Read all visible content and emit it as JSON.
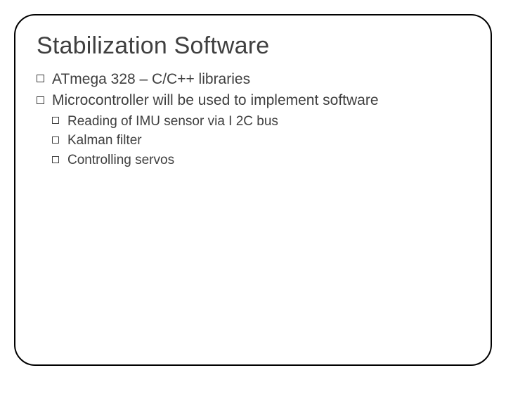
{
  "slide": {
    "title": "Stabilization Software",
    "bullets": [
      {
        "text": "ATmega 328 – C/C++ libraries",
        "children": []
      },
      {
        "text": "Microcontroller will be used to implement software",
        "children": [
          {
            "text": "Reading of IMU sensor via I 2C bus"
          },
          {
            "text": "Kalman filter"
          },
          {
            "text": "Controlling servos"
          }
        ]
      }
    ]
  }
}
